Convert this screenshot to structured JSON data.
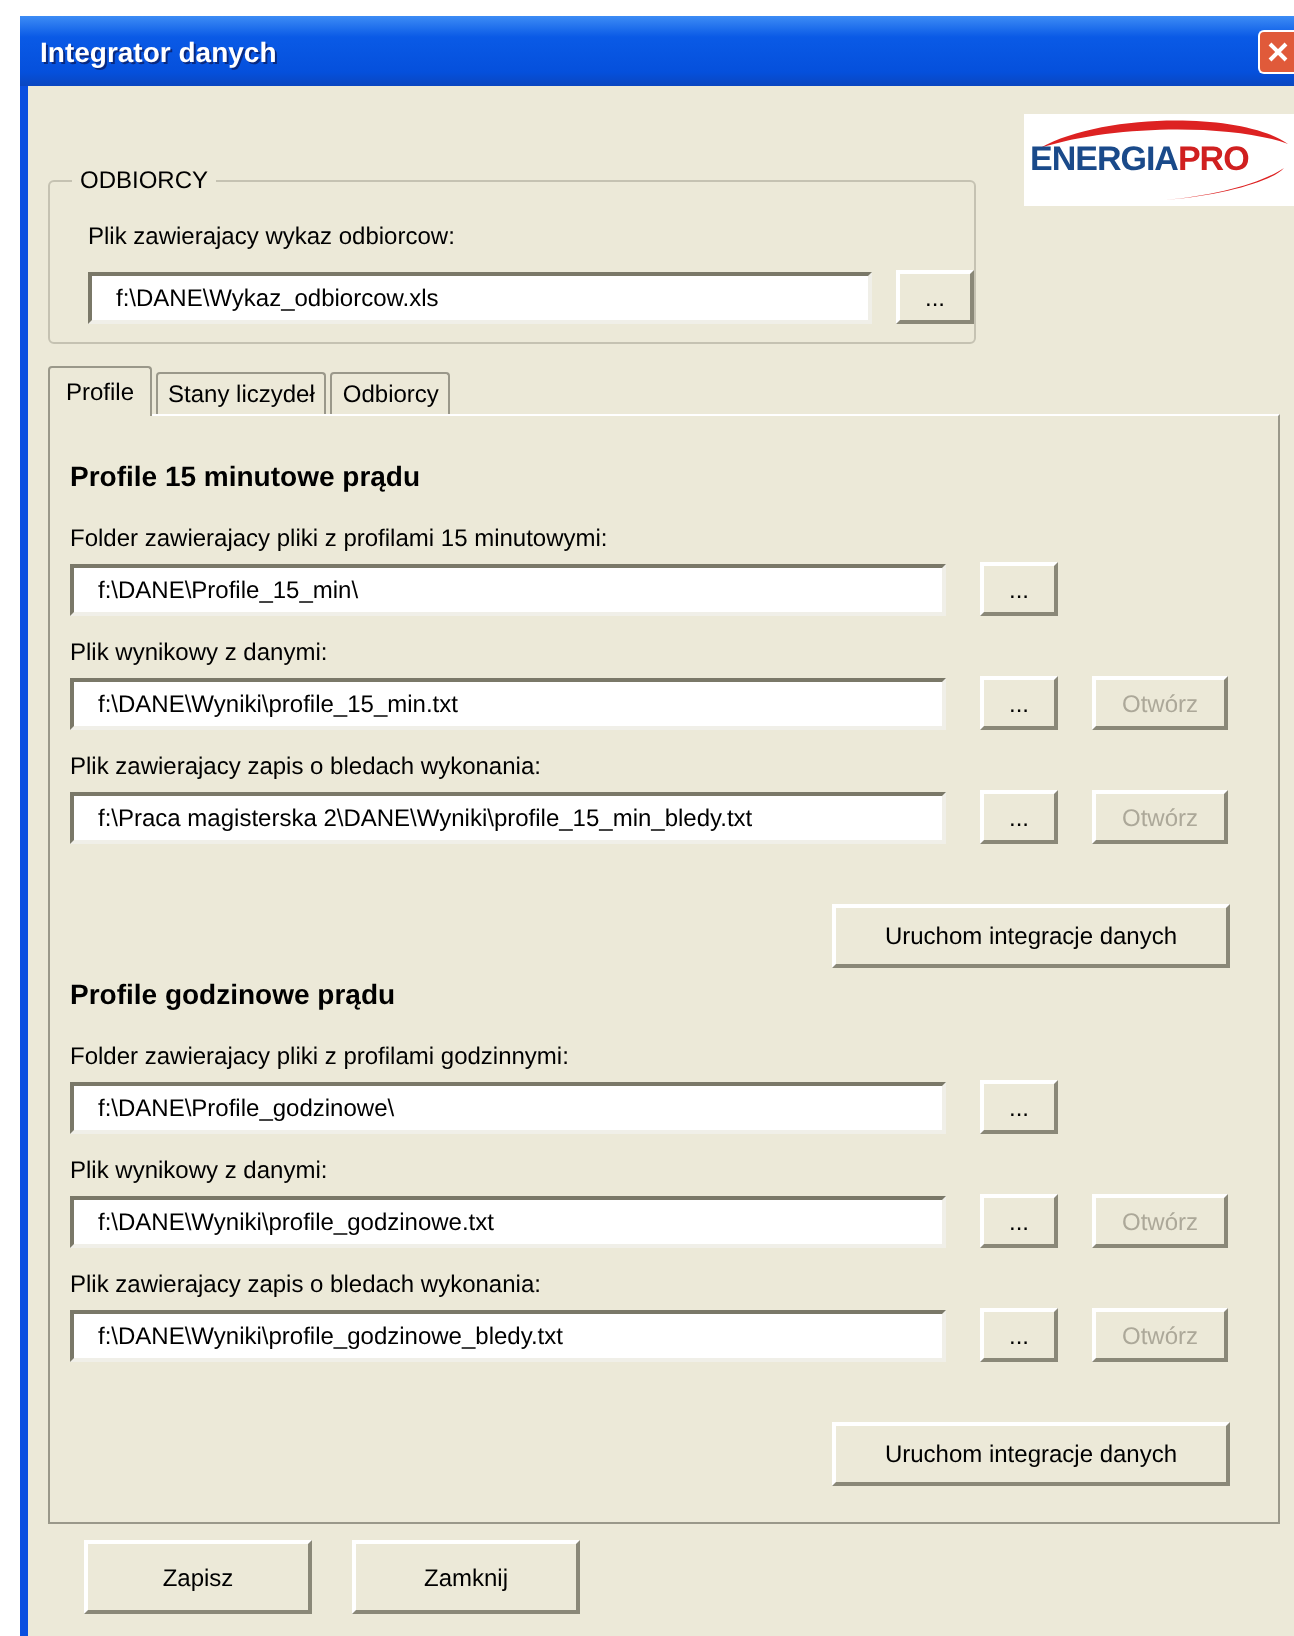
{
  "window": {
    "title": "Integrator danych"
  },
  "logo": {
    "parts": [
      "ENERGIA",
      "PRO"
    ]
  },
  "odbiorcy": {
    "legend": "ODBIORCY",
    "label": "Plik zawierajacy wykaz odbiorcow:",
    "value": "f:\\DANE\\Wykaz_odbiorcow.xls",
    "browse": "..."
  },
  "tabs": [
    {
      "label": "Profile",
      "selected": true
    },
    {
      "label": "Stany liczydeł",
      "selected": false
    },
    {
      "label": "Odbiorcy",
      "selected": false
    }
  ],
  "sections": [
    {
      "heading": "Profile 15 minutowe prądu",
      "fields": [
        {
          "label": "Folder zawierajacy pliki z profilami 15 minutowymi:",
          "value": "f:\\DANE\\Profile_15_min\\",
          "browse": "..."
        },
        {
          "label": "Plik wynikowy z danymi:",
          "value": "f:\\DANE\\Wyniki\\profile_15_min.txt",
          "browse": "...",
          "open": {
            "label": "Otwórz",
            "disabled": true
          }
        },
        {
          "label": "Plik zawierajacy zapis o bledach wykonania:",
          "value": "f:\\Praca magisterska 2\\DANE\\Wyniki\\profile_15_min_bledy.txt",
          "browse": "...",
          "open": {
            "label": "Otwórz",
            "disabled": true
          }
        }
      ],
      "run_button": "Uruchom integracje danych"
    },
    {
      "heading": "Profile godzinowe prądu",
      "fields": [
        {
          "label": "Folder zawierajacy pliki z profilami godzinnymi:",
          "value": "f:\\DANE\\Profile_godzinowe\\",
          "browse": "..."
        },
        {
          "label": "Plik wynikowy z danymi:",
          "value": "f:\\DANE\\Wyniki\\profile_godzinowe.txt",
          "browse": "...",
          "open": {
            "label": "Otwórz",
            "disabled": true
          }
        },
        {
          "label": "Plik zawierajacy zapis o bledach wykonania:",
          "value": "f:\\DANE\\Wyniki\\profile_godzinowe_bledy.txt",
          "browse": "...",
          "open": {
            "label": "Otwórz",
            "disabled": true
          }
        }
      ],
      "run_button": "Uruchom integracje danych"
    }
  ],
  "buttons": [
    "Zapisz",
    "Zamknij"
  ]
}
